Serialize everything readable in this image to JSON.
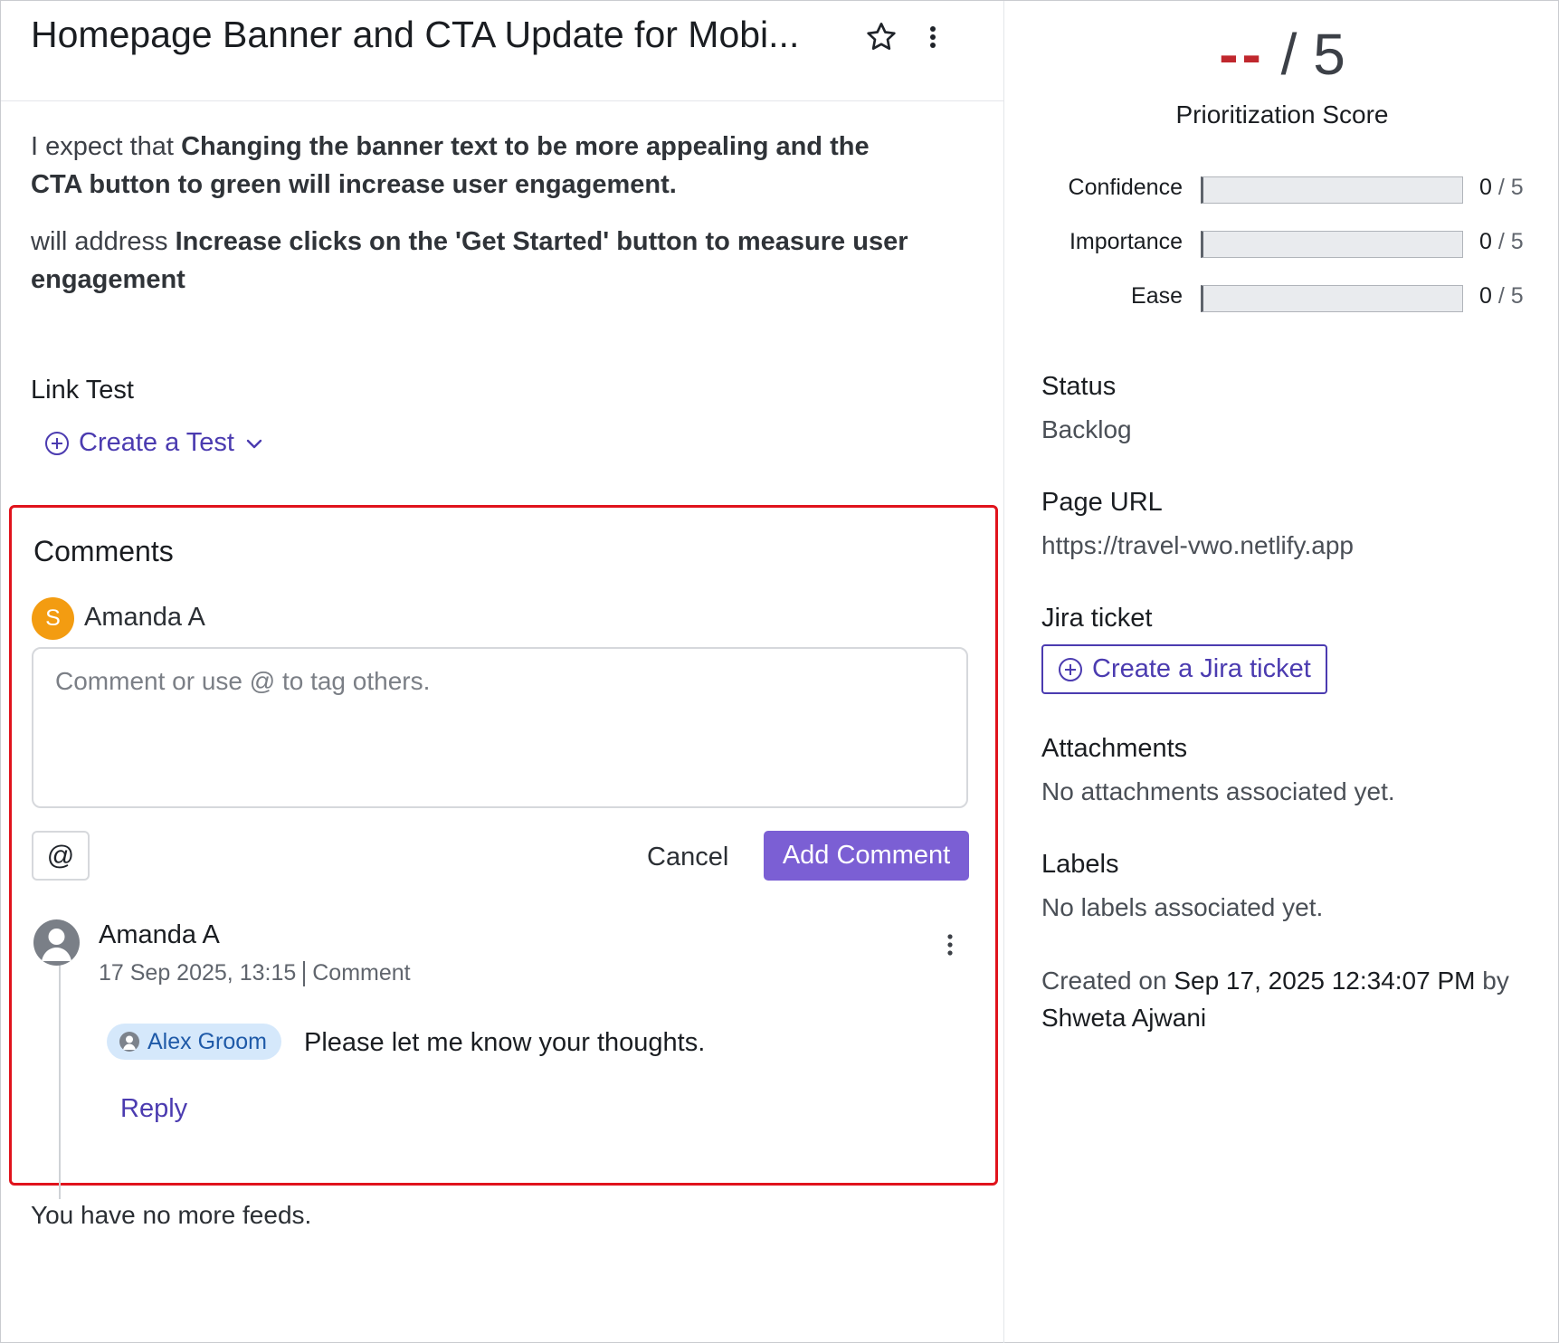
{
  "header": {
    "title": "Homepage Banner and CTA Update for Mobi..."
  },
  "hypothesis": {
    "expect_prefix": "I expect that",
    "expect_text": "Changing the banner text to be more appealing and the CTA button to green will increase user engagement.",
    "address_prefix": "will address",
    "address_text": "Increase clicks on the 'Get Started' button to measure user engagement"
  },
  "link_test": {
    "label": "Link Test",
    "create_label": "Create a Test"
  },
  "comments": {
    "title": "Comments",
    "current_user_initial": "S",
    "current_user_name": "Amanda A",
    "input_placeholder": "Comment or use @ to tag others.",
    "input_value": "",
    "at_label": "@",
    "cancel_label": "Cancel",
    "add_label": "Add Comment",
    "items": [
      {
        "author": "Amanda A",
        "date": "17 Sep 2025, 13:15",
        "type": "Comment",
        "mention": "Alex Groom",
        "text": "Please let me know your thoughts.",
        "reply_label": "Reply"
      }
    ],
    "no_more_feeds": "You have no more feeds."
  },
  "score": {
    "value": "--",
    "max_label": "/ 5",
    "label": "Prioritization Score",
    "metrics": [
      {
        "label": "Confidence",
        "value": "0",
        "max": "/ 5",
        "fraction": 0
      },
      {
        "label": "Importance",
        "value": "0",
        "max": "/ 5",
        "fraction": 0
      },
      {
        "label": "Ease",
        "value": "0",
        "max": "/ 5",
        "fraction": 0
      }
    ]
  },
  "details": {
    "status_title": "Status",
    "status_value": "Backlog",
    "url_title": "Page URL",
    "url_value": "https://travel-vwo.netlify.app",
    "jira_title": "Jira ticket",
    "jira_button": "Create a Jira ticket",
    "attachments_title": "Attachments",
    "attachments_value": "No attachments associated yet.",
    "labels_title": "Labels",
    "labels_value": "No labels associated yet.",
    "created_prefix": "Created on",
    "created_date": "Sep 17, 2025 12:34:07 PM",
    "created_by_word": "by",
    "created_by": "Shweta Ajwani"
  },
  "colors": {
    "accent": "#4b3bb0",
    "primary_button": "#7b5fd4",
    "score_dash": "#c0272d",
    "highlight_border": "#e0131c",
    "avatar_orange": "#f39c11",
    "mention_bg": "#d5e8fb"
  },
  "icons": {
    "favorite": "star-icon",
    "more": "kebab-icon",
    "add": "plus-circle-icon",
    "dropdown": "chevron-down-icon",
    "user": "user-avatar-icon"
  }
}
